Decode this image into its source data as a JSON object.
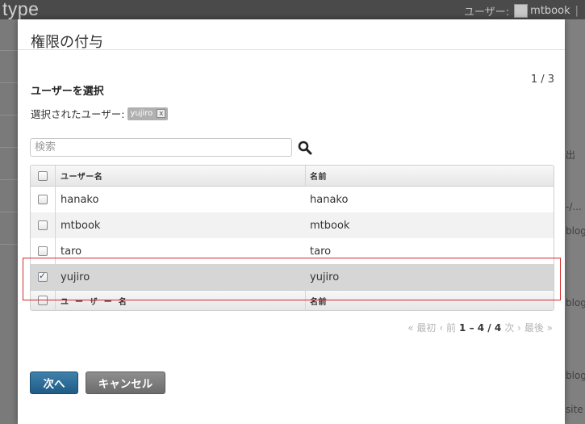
{
  "app": {
    "logo": "type",
    "logo_mark": "™",
    "user_label": "ユーザー:",
    "user_name": "mtbook",
    "sep": "|"
  },
  "bg_right_texts": [
    "出",
    "-/...",
    "blog",
    "blog",
    "blog",
    "site"
  ],
  "dialog": {
    "title": "権限の付与",
    "page_counter": "1 / 3",
    "section_title": "ユーザーを選択",
    "selected_label": "選択されたユーザー:",
    "selected_tags": [
      {
        "label": "yujiro",
        "remove": "x"
      }
    ],
    "search": {
      "placeholder": "検索",
      "value": ""
    },
    "table": {
      "head": {
        "col_a": "ユーザー名",
        "col_b": "名前"
      },
      "rows": [
        {
          "username": "hanako",
          "name": "hanako",
          "checked": false
        },
        {
          "username": "mtbook",
          "name": "mtbook",
          "checked": false
        },
        {
          "username": "taro",
          "name": "taro",
          "checked": false
        },
        {
          "username": "yujiro",
          "name": "yujiro",
          "checked": true
        }
      ],
      "foot": {
        "col_a": "ユーザー名",
        "col_b": "名前"
      }
    },
    "pager": {
      "first": "« 最初",
      "prev": "‹ 前",
      "range": "1 – 4 / 4",
      "next": "次 ›",
      "last": "最後 »"
    },
    "buttons": {
      "next": "次へ",
      "cancel": "キャンセル"
    }
  },
  "colors": {
    "primary_button": "#2a6b96",
    "cancel_button": "#7b7b7b",
    "highlight": "#d42a2a"
  }
}
